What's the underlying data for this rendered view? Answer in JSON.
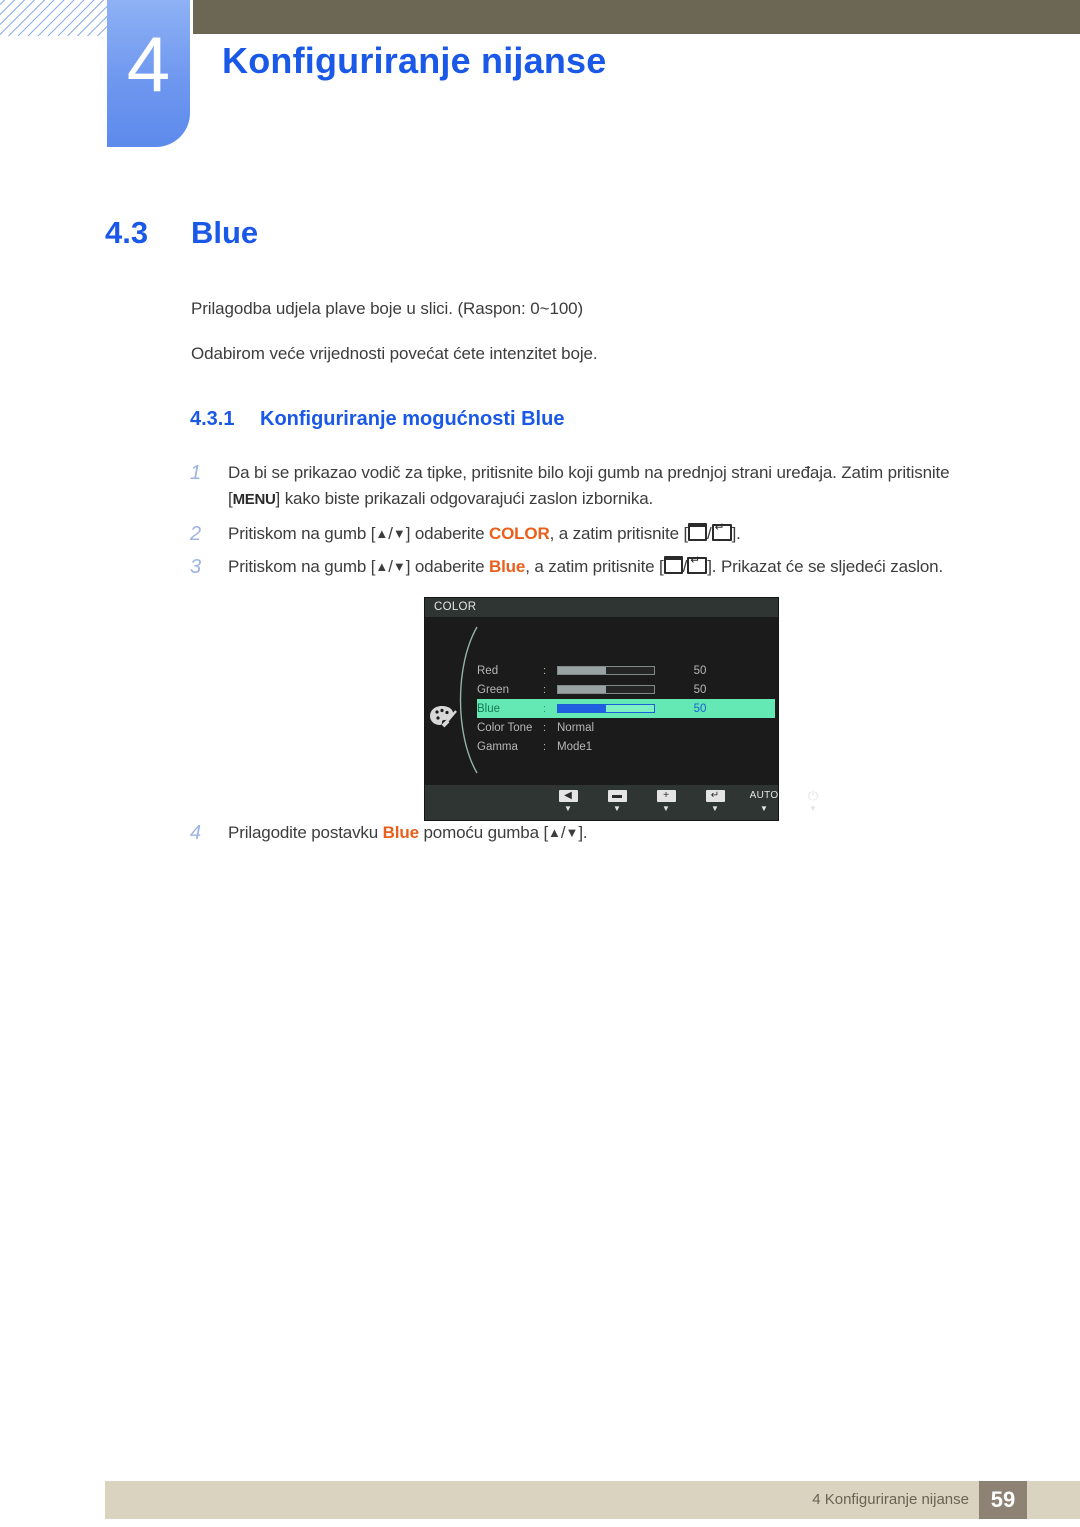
{
  "header": {
    "chapter_number": "4",
    "chapter_title": "Konfiguriranje nijanse"
  },
  "section": {
    "number": "4.3",
    "title": "Blue",
    "paragraphs": [
      "Prilagodba udjela plave boje u slici. (Raspon: 0~100)",
      "Odabirom veće vrijednosti povećat ćete intenzitet boje."
    ]
  },
  "subsection": {
    "number": "4.3.1",
    "title": "Konfiguriranje mogućnosti Blue"
  },
  "steps": [
    {
      "index": "1",
      "part_a": "Da bi se prikazao vodič za tipke, pritisnite bilo koji gumb na prednjoj strani uređaja. Zatim pritisnite",
      "bracket_open": "[",
      "menu_label": "MENU",
      "bracket_close": "]",
      "part_b": " kako biste prikazali odgovarajući zaslon izbornika."
    },
    {
      "index": "2",
      "lead": "Pritiskom na gumb [",
      "up": "▲",
      "slash": "/",
      "down": "▼",
      "mid": "] odaberite ",
      "keyword": "COLOR",
      "mid2": ", a zatim pritisnite [",
      "slash2": "/",
      "tail": "]."
    },
    {
      "index": "3",
      "lead": "Pritiskom na gumb [",
      "up": "▲",
      "slash": "/",
      "down": "▼",
      "mid": "] odaberite ",
      "keyword": "Blue",
      "mid2": ", a zatim pritisnite [",
      "slash2": "/",
      "tail": "]. Prikazat će se sljedeći zaslon."
    },
    {
      "index": "4",
      "lead": "Prilagodite postavku ",
      "keyword": "Blue",
      "mid": " pomoću gumba [",
      "up": "▲",
      "slash": "/",
      "down": "▼",
      "tail": "]."
    }
  ],
  "osd": {
    "title": "COLOR",
    "rows": [
      {
        "label": "Red",
        "colon": ":",
        "type": "slider",
        "fill_percent": 50,
        "value": "50",
        "selected": false
      },
      {
        "label": "Green",
        "colon": ":",
        "type": "slider",
        "fill_percent": 50,
        "value": "50",
        "selected": false
      },
      {
        "label": "Blue",
        "colon": ":",
        "type": "slider",
        "fill_percent": 50,
        "value": "50",
        "selected": true
      },
      {
        "label": "Color Tone",
        "colon": ":",
        "type": "text",
        "value": "Normal",
        "selected": false
      },
      {
        "label": "Gamma",
        "colon": ":",
        "type": "text",
        "value": "Mode1",
        "selected": false
      }
    ],
    "footer_keys": [
      {
        "icon": "left-arrow-key",
        "glyph": "◀",
        "caret": "▼"
      },
      {
        "icon": "minus-key",
        "glyph": "▬",
        "caret": "▼"
      },
      {
        "icon": "plus-key",
        "glyph": "+",
        "caret": "▼"
      },
      {
        "icon": "enter-key",
        "glyph": "↵",
        "caret": "▼"
      },
      {
        "icon": "auto-key",
        "glyph": "AUTO",
        "caret": "▼"
      },
      {
        "icon": "power-key",
        "glyph": "⏻",
        "caret": "▼"
      }
    ],
    "colors": {
      "panel_bg": "#1b1b1b",
      "title_bg": "#2e3533",
      "highlight": "#64e9b4",
      "slider_fill_selected": "#1f5fe0",
      "slider_fill": "#9aa3a3"
    }
  },
  "footer": {
    "text": "4 Konfiguriranje nijanse",
    "page": "59"
  },
  "theme": {
    "accent_blue": "#1a58e8",
    "keyword_orange": "#e8601c",
    "olive": "#6b6754",
    "footer_bar": "#d9d3c0",
    "page_badge": "#8e8275"
  }
}
